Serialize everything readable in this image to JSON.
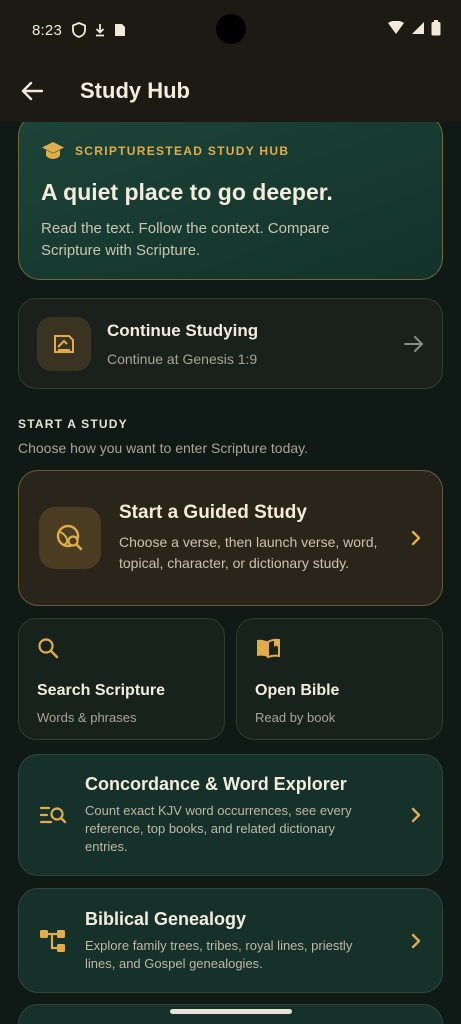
{
  "status": {
    "time": "8:23"
  },
  "appbar": {
    "title": "Study Hub"
  },
  "hero": {
    "kicker": "SCRIPTURESTEAD STUDY HUB",
    "title": "A quiet place to go deeper.",
    "body": "Read the text. Follow the context. Compare Scripture with Scripture."
  },
  "continue": {
    "title": "Continue Studying",
    "subtitle": "Continue at Genesis 1:9"
  },
  "section": {
    "heading": "START A STUDY",
    "subheading": "Choose how you want to enter Scripture today."
  },
  "guided": {
    "title": "Start a Guided Study",
    "subtitle": "Choose a verse, then launch verse, word, topical, character, or dictionary study."
  },
  "tiles": [
    {
      "title": "Search Scripture",
      "subtitle": "Words & phrases"
    },
    {
      "title": "Open Bible",
      "subtitle": "Read by book"
    }
  ],
  "concordance": {
    "title": "Concordance & Word Explorer",
    "subtitle": "Count exact KJV word occurrences, see every reference, top books, and related dictionary entries."
  },
  "genealogy": {
    "title": "Biblical Genealogy",
    "subtitle": "Explore family trees, tribes, royal lines, priestly lines, and Gospel genealogies."
  },
  "colors": {
    "accent": "#e0ac4c",
    "background": "#0f1a16",
    "appbar": "#1c1a12"
  }
}
